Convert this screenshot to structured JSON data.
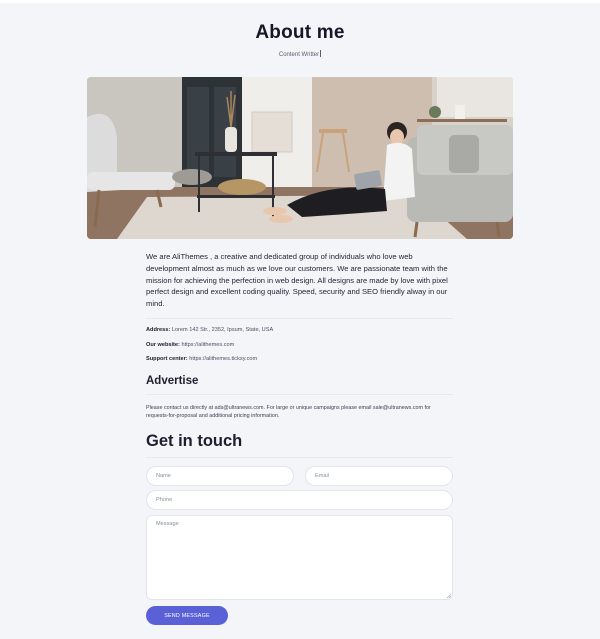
{
  "page": {
    "title": "About me",
    "subtitle": "Content Writter"
  },
  "hero": {
    "image": "living-room-woman-with-laptop-photo"
  },
  "intro": {
    "text": "We are AliThemes , a creative and dedicated group of individuals who love web development almost as much as we love our customers. We are passionate team with the mission for achieving the perfection in web design. All designs are made by love with pixel perfect design and excellent coding quality. Speed, security and SEO friendly alway in our mind."
  },
  "contact_info": {
    "address_label": "Address:",
    "address_value": "Lorem 142 Str., 2352, Ipsum, State, USA",
    "website_label": "Our website:",
    "website_value": "https://alithemes.com",
    "support_label": "Support center:",
    "support_value": "https://alithemes.ticksy.com"
  },
  "advertise": {
    "heading": "Advertise",
    "text": "Please contact us directly at ads@ultranews.com. For large or unique campaigns please email sale@ultranews.com for requests-for-proposal and additional pricing information."
  },
  "contact_form": {
    "heading": "Get in touch",
    "name_placeholder": "Name",
    "email_placeholder": "Email",
    "phone_placeholder": "Phone",
    "message_placeholder": "Message",
    "submit_label": "SEND MESSAGE"
  },
  "colors": {
    "background": "#f4f5f8",
    "accent": "#5a60d6",
    "heading": "#151826"
  }
}
